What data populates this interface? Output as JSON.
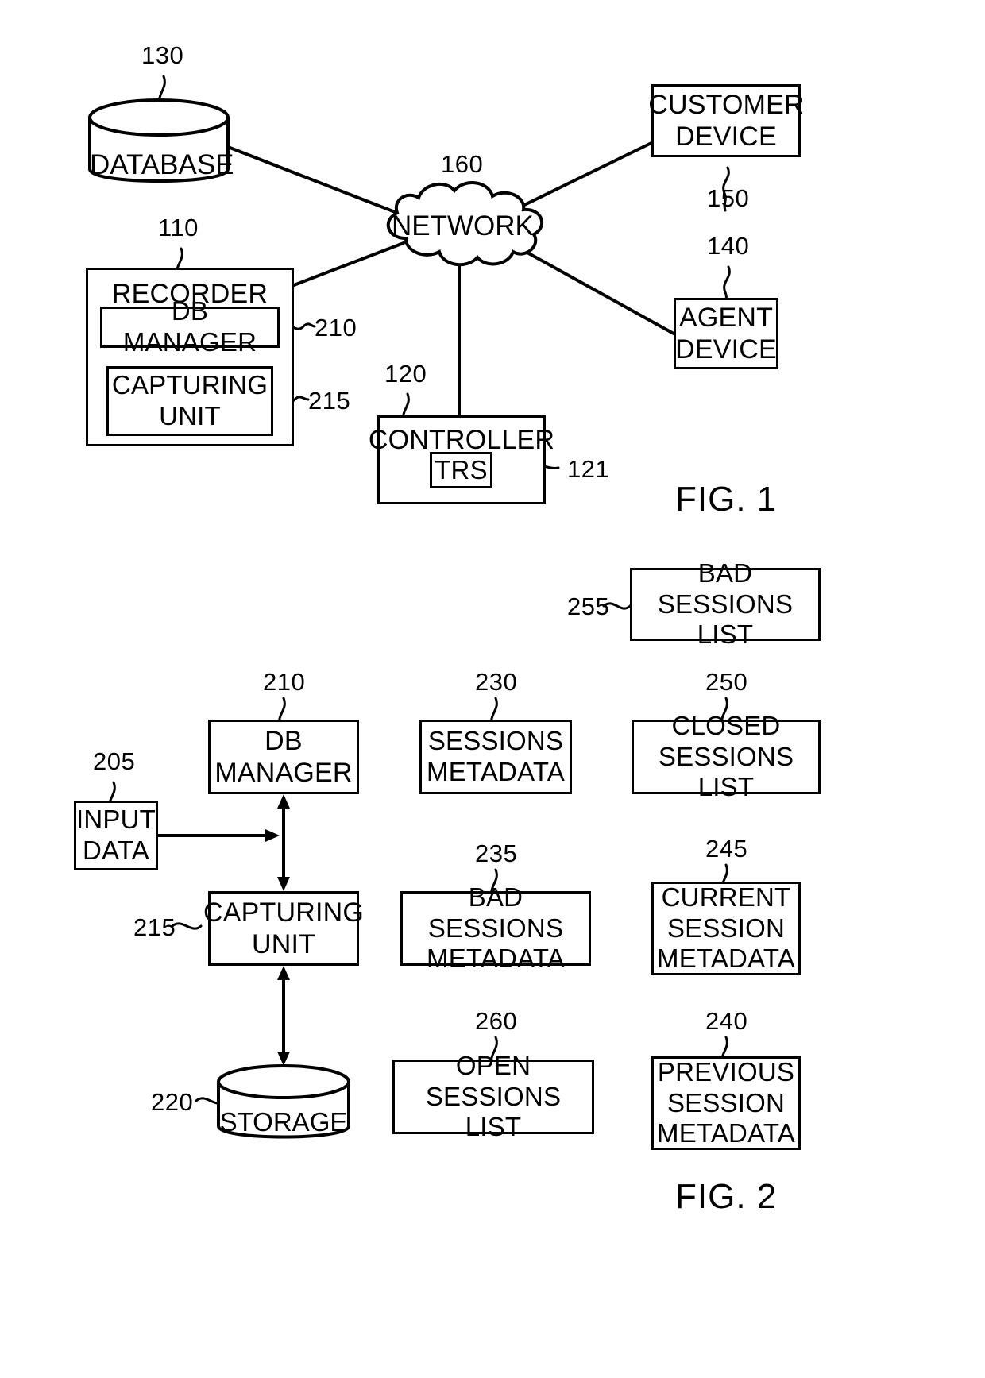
{
  "figure1": {
    "caption": "FIG. 1",
    "nodes": {
      "database": {
        "label": "DATABASE",
        "ref": "130"
      },
      "recorder": {
        "label": "RECORDER",
        "ref": "110"
      },
      "db_manager": {
        "label": "DB MANAGER",
        "ref": "210"
      },
      "capturing_unit": {
        "label": "CAPTURING\nUNIT",
        "ref": "215"
      },
      "network": {
        "label": "NETWORK",
        "ref": "160"
      },
      "controller": {
        "label": "CONTROLLER",
        "ref": "120"
      },
      "trs": {
        "label": "TRS",
        "ref": "121"
      },
      "customer_device": {
        "label": "CUSTOMER\nDEVICE",
        "ref": "150"
      },
      "agent_device": {
        "label": "AGENT\nDEVICE",
        "ref": "140"
      }
    }
  },
  "figure2": {
    "caption": "FIG. 2",
    "nodes": {
      "bad_sessions_list": {
        "label": "BAD SESSIONS\nLIST",
        "ref": "255"
      },
      "input_data": {
        "label": "INPUT\nDATA",
        "ref": "205"
      },
      "db_manager": {
        "label": "DB\nMANAGER",
        "ref": "210"
      },
      "sessions_metadata": {
        "label": "SESSIONS\nMETADATA",
        "ref": "230"
      },
      "closed_sessions_list": {
        "label": "CLOSED\nSESSIONS LIST",
        "ref": "250"
      },
      "capturing_unit": {
        "label": "CAPTURING\nUNIT",
        "ref": "215"
      },
      "bad_sessions_metadata": {
        "label": "BAD SESSIONS\nMETADATA",
        "ref": "235"
      },
      "current_session_metadata": {
        "label": "CURRENT\nSESSION\nMETADATA",
        "ref": "245"
      },
      "storage": {
        "label": "STORAGE",
        "ref": "220"
      },
      "open_sessions_list": {
        "label": "OPEN SESSIONS\nLIST",
        "ref": "260"
      },
      "previous_session_metadata": {
        "label": "PREVIOUS\nSESSION\nMETADATA",
        "ref": "240"
      }
    }
  },
  "colors": {
    "ink": "#000000",
    "paper": "#ffffff"
  }
}
